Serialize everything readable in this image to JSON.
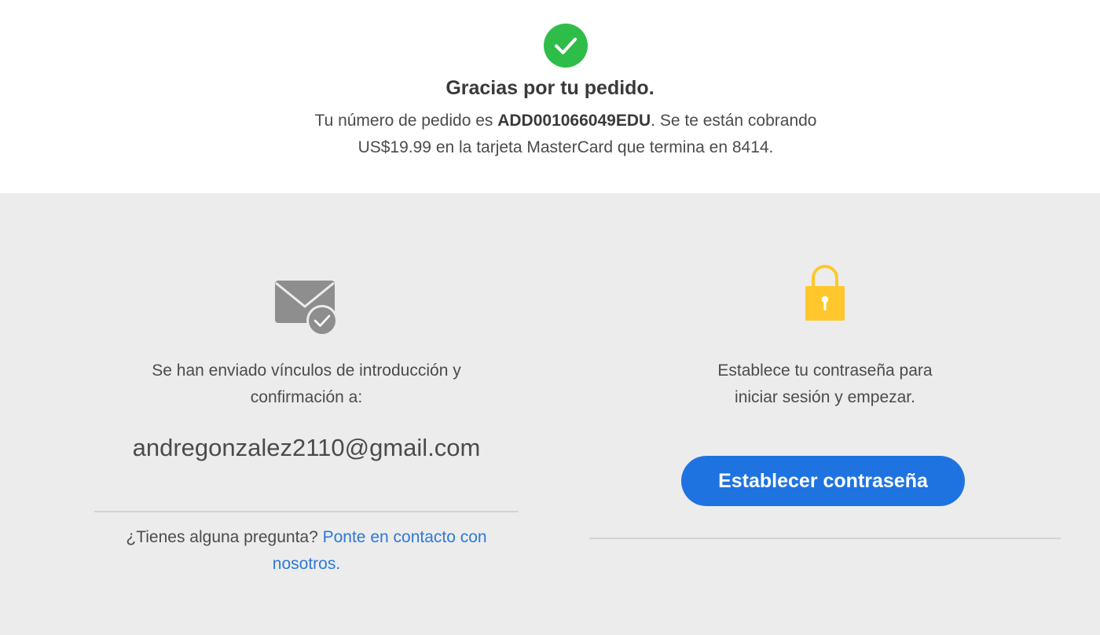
{
  "confirmation": {
    "title": "Gracias por tu pedido.",
    "order_prefix": "Tu número de pedido es ",
    "order_number": "ADD001066049EDU",
    "order_suffix": ". Se te están cobrando US$19.99 en la tarjeta MasterCard que termina en 8414."
  },
  "email_section": {
    "sent_text": "Se han enviado vínculos de introducción y confirmación a:",
    "email": "andregonzalez2110@gmail.com",
    "question_text": "¿Tienes alguna pregunta? ",
    "contact_link": "Ponte en contacto con nosotros."
  },
  "password_section": {
    "text": "Establece tu contraseña para iniciar sesión y empezar.",
    "button_label": "Establecer contraseña"
  },
  "colors": {
    "success_green": "#2fbd4a",
    "accent_blue": "#1e73e0",
    "lock_yellow": "#ffc72c",
    "mail_gray": "#8e8e8e"
  },
  "icons": {
    "success": "check-circle-icon",
    "mail": "mail-check-icon",
    "lock": "lock-icon"
  }
}
